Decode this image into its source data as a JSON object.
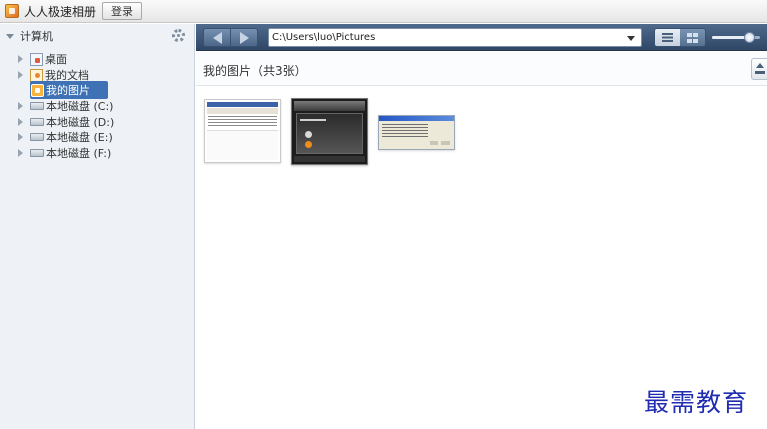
{
  "titlebar": {
    "app_title": "人人极速相册",
    "login_label": "登录"
  },
  "sidebar": {
    "title": "计算机",
    "items": [
      {
        "label": "桌面",
        "icon": "desktop-icon",
        "expandable": true,
        "selected": false
      },
      {
        "label": "我的文档",
        "icon": "documents-icon",
        "expandable": true,
        "selected": false
      },
      {
        "label": "我的图片",
        "icon": "pictures-icon",
        "expandable": false,
        "selected": true
      },
      {
        "label": "本地磁盘 (C:)",
        "icon": "disk-icon",
        "expandable": true,
        "selected": false
      },
      {
        "label": "本地磁盘 (D:)",
        "icon": "disk-icon",
        "expandable": true,
        "selected": false
      },
      {
        "label": "本地磁盘 (E:)",
        "icon": "disk-icon",
        "expandable": true,
        "selected": false
      },
      {
        "label": "本地磁盘 (F:)",
        "icon": "disk-icon",
        "expandable": true,
        "selected": false
      }
    ]
  },
  "toolbar": {
    "path": "C:\\Users\\luo\\Pictures",
    "view_mode": "list",
    "zoom_level": 0.78
  },
  "content": {
    "folder_title": "我的图片（共3张）",
    "thumbnails": [
      "thumbnail-1",
      "thumbnail-2",
      "thumbnail-3"
    ]
  },
  "watermark": "最需教育",
  "colors": {
    "toolbar": "#3a5577",
    "selection": "#3f72b5",
    "sidebar_bg": "#eef2f6"
  }
}
